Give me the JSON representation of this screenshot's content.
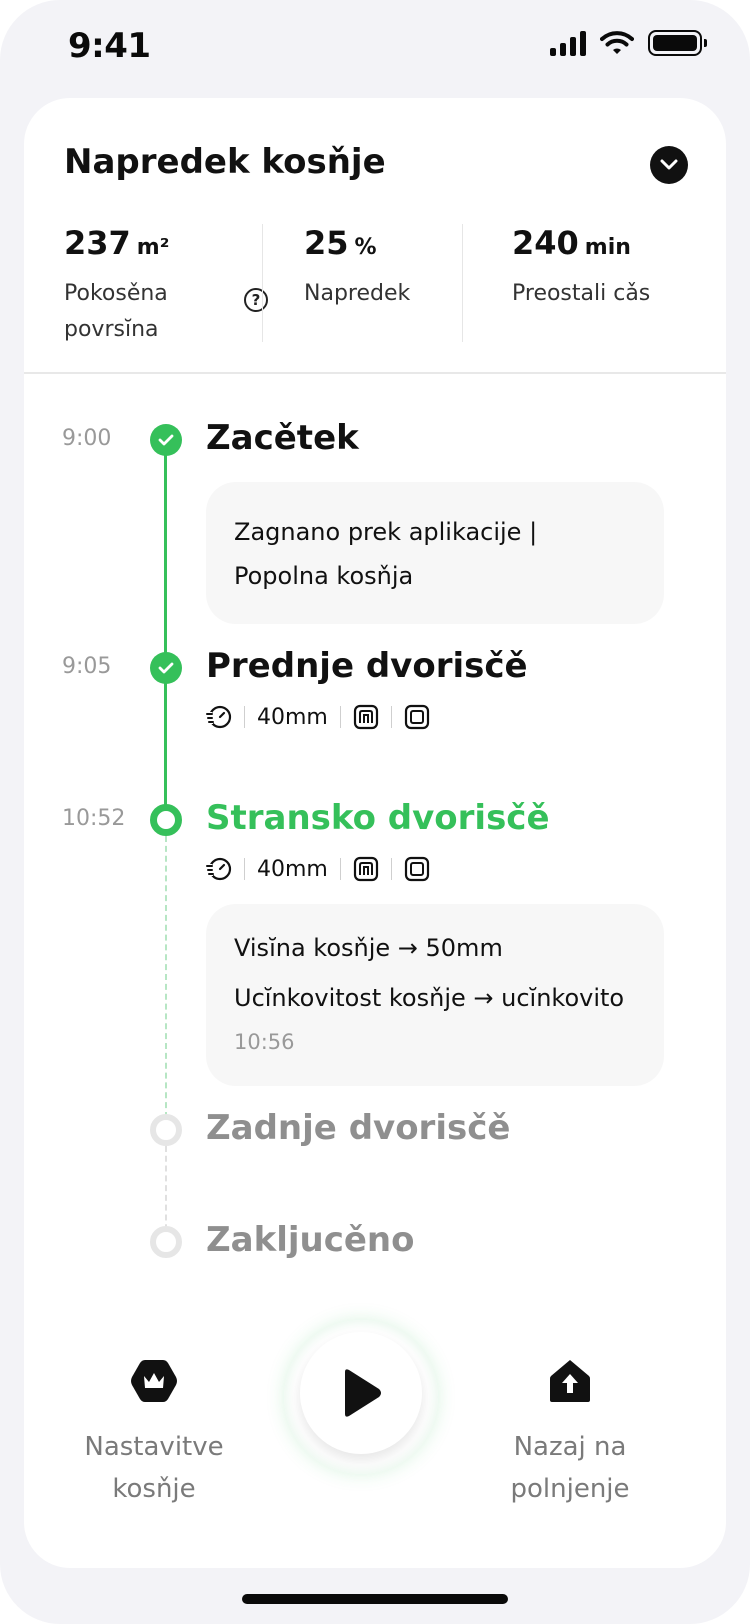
{
  "status_bar": {
    "time": "9:41"
  },
  "header": {
    "title": "Napredek kosňje"
  },
  "stats": [
    {
      "value": "237",
      "unit": "m²",
      "label": "Pokosěna povrsĭna"
    },
    {
      "value": "25",
      "unit": "%",
      "label": "Napredek"
    },
    {
      "value": "240",
      "unit": "min",
      "label": "Preostali cǎs"
    }
  ],
  "timeline": {
    "start": {
      "time": "9:00",
      "title": "Zacětek",
      "note": "Zagnano prek aplikacije | Popolna kosňja"
    },
    "front_yard": {
      "time": "9:05",
      "title": "Prednje dvorisčě",
      "height": "40mm"
    },
    "side_yard": {
      "time": "10:52",
      "title": "Stransko dvorisčě",
      "height": "40mm",
      "note_lines": [
        "Visĭna kosňje → 50mm",
        "Ucĭnkovitost kosňje → ucĭnkovito"
      ],
      "note_time": "10:56"
    },
    "back_yard": {
      "title": "Zadnje dvorisčě"
    },
    "finished": {
      "title": "Zakljucěno"
    }
  },
  "actions": {
    "settings": {
      "label": "Nastavitve kosňje",
      "icon": "crown-hexagon-icon"
    },
    "play": {
      "icon": "play-icon"
    },
    "return": {
      "label": "Nazaj na polnjenje",
      "icon": "home-arrow-up-icon"
    }
  },
  "colors": {
    "accent": "#35c05a",
    "pending": "#8f8f8f",
    "background": "#f3f3f7"
  }
}
